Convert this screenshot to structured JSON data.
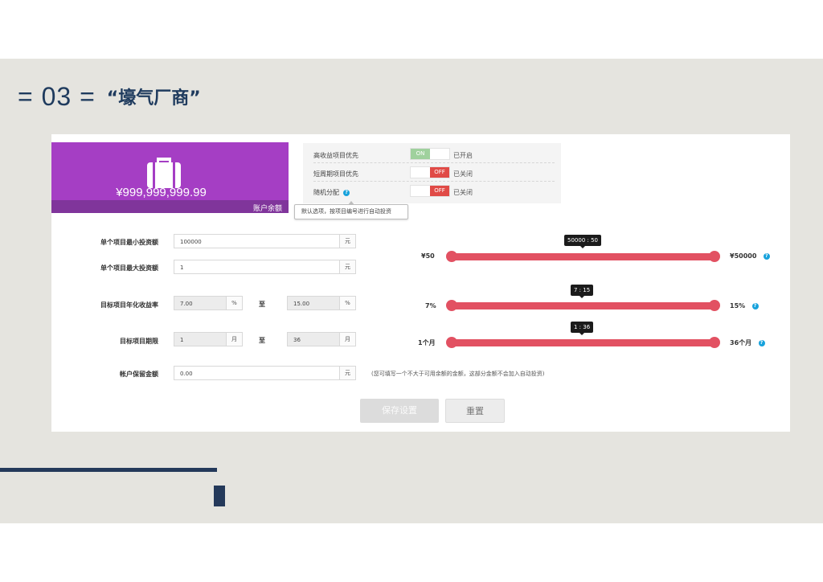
{
  "slide": {
    "number": "= 03 =",
    "title": "“壕气厂商”"
  },
  "balance": {
    "amount": "¥999,999,999.99",
    "label": "账户余额",
    "icon": "briefcase-icon"
  },
  "options": [
    {
      "label": "高收益项目优先",
      "state": "on",
      "on_text": "ON",
      "status": "已开启"
    },
    {
      "label": "短周期项目优先",
      "state": "off",
      "off_text": "OFF",
      "status": "已关闭"
    },
    {
      "label": "随机分配",
      "state": "off",
      "off_text": "OFF",
      "status": "已关闭",
      "help": "?"
    }
  ],
  "tooltip": "默认选项，按项目编号进行自动投资",
  "form": {
    "min_invest": {
      "label": "单个项目最小投资额",
      "value": "100000",
      "unit": "元"
    },
    "max_invest": {
      "label": "单个项目最大投资额",
      "value": "1",
      "unit": "元"
    },
    "rate": {
      "label": "目标项目年化收益率",
      "from": "7.00",
      "to_value": "15.00",
      "unit": "%",
      "to": "至"
    },
    "term": {
      "label": "目标项目期限",
      "from": "1",
      "to_value": "36",
      "unit": "月",
      "to": "至"
    },
    "reserve": {
      "label": "帐户保留金额",
      "value": "0.00",
      "unit": "元",
      "note": "(您可填写一个不大于可用余额的金额，这部分金额不会加入自动投资)"
    }
  },
  "sliders": [
    {
      "min": "¥50",
      "max": "¥50000",
      "bubble": "50000 : 50",
      "value_fraction": 0.5
    },
    {
      "min": "7%",
      "max": "15%",
      "bubble": "7 : 15",
      "value_fraction": 0.5
    },
    {
      "min": "1个月",
      "max": "36个月",
      "bubble": "1 : 36",
      "value_fraction": 0.5
    }
  ],
  "buttons": {
    "save": "保存设置",
    "reset": "重置"
  },
  "colors": {
    "accent_purple": "#a53ec4",
    "slider_red": "#e25162",
    "switch_on": "#9fd19d",
    "switch_off": "#e04a46",
    "help_blue": "#17a2dc",
    "navy": "#24395a"
  }
}
